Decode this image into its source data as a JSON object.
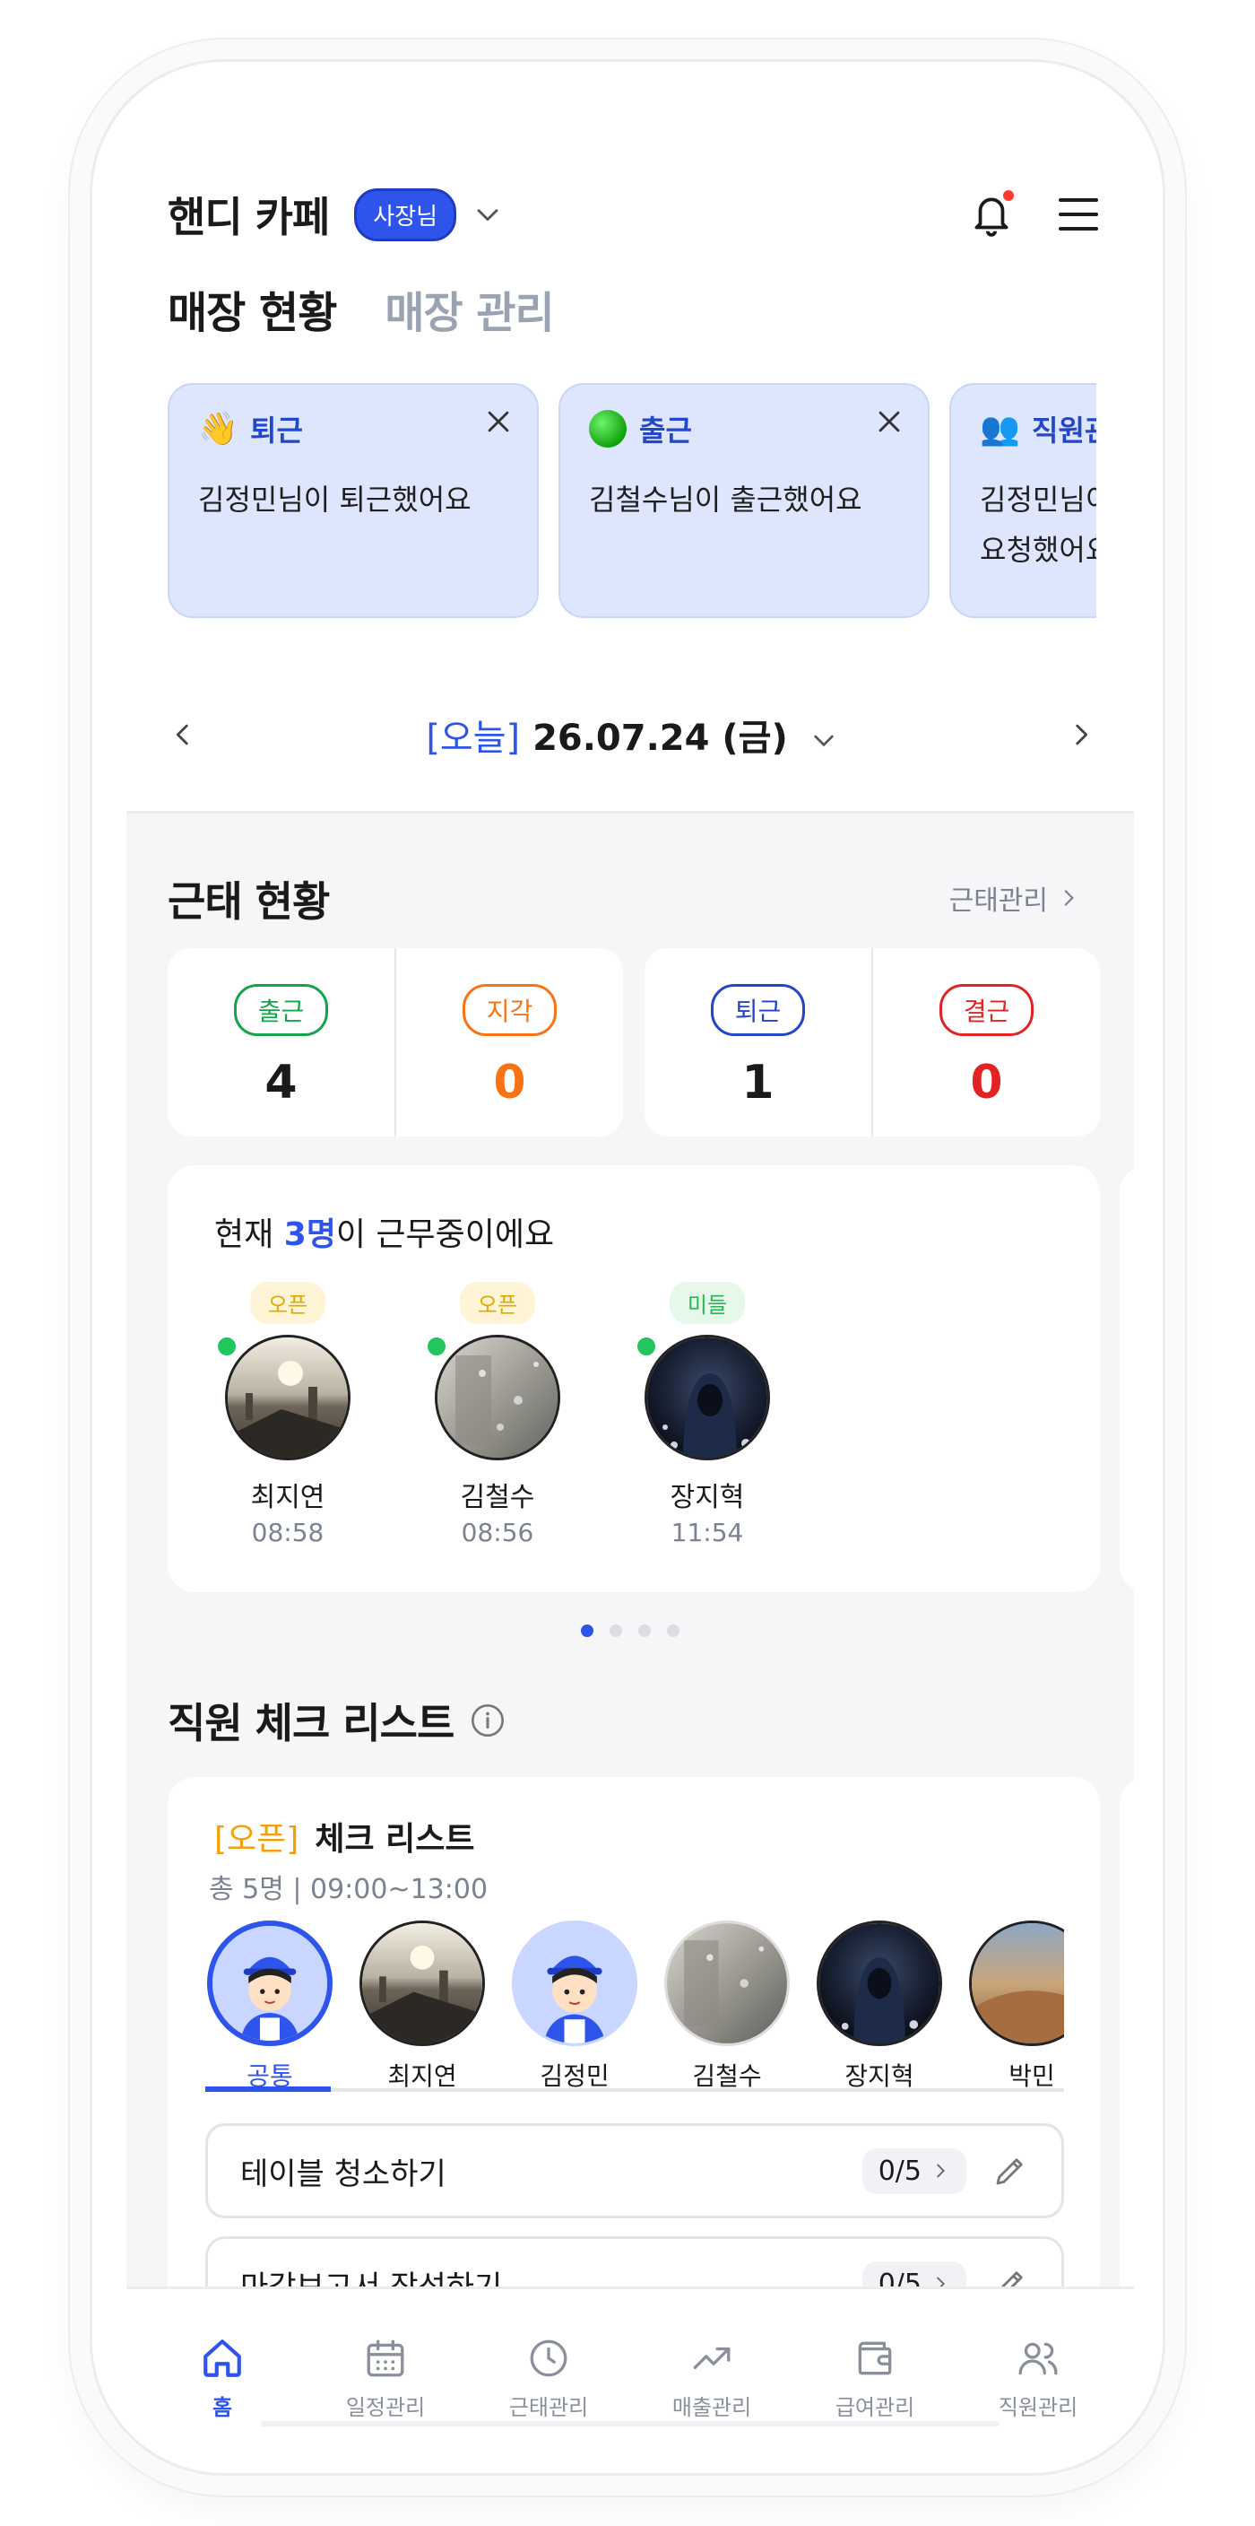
{
  "header": {
    "store_name": "핸디 카페",
    "role_badge": "사장님"
  },
  "tabs": [
    {
      "label": "매장 현황",
      "active": true
    },
    {
      "label": "매장 관리",
      "active": false
    }
  ],
  "notifications": [
    {
      "icon": "wave-emoji",
      "type": "퇴근",
      "message": "김정민님이 퇴근했어요"
    },
    {
      "icon": "green-circle",
      "type": "출근",
      "message": "김철수님이 출근했어요"
    },
    {
      "icon": "people-emoji",
      "type": "직원관리",
      "message": "김정민님이 미 요청했어요"
    }
  ],
  "date_nav": {
    "today_tag": "[오늘]",
    "date": "26.07.24 (금)"
  },
  "attendance": {
    "title": "근태 현황",
    "link": "근태관리",
    "stats": [
      {
        "label": "출근",
        "value": "4",
        "color": "#16a34a"
      },
      {
        "label": "지각",
        "value": "0",
        "color": "#f97316"
      },
      {
        "label": "퇴근",
        "value": "1",
        "color": "#2446c8"
      },
      {
        "label": "결근",
        "value": "0",
        "color": "#e02424"
      }
    ]
  },
  "working_now": {
    "prefix": "현재 ",
    "count": "3명",
    "suffix": "이 근무중이에요",
    "workers": [
      {
        "shift": "오픈",
        "name": "최지연",
        "time": "08:58",
        "photo": "city-sunset"
      },
      {
        "shift": "오픈",
        "name": "김철수",
        "time": "08:56",
        "photo": "rainy-window"
      },
      {
        "shift": "미들",
        "name": "장지혁",
        "time": "11:54",
        "photo": "hooded-figure"
      }
    ],
    "pager": {
      "count": 4,
      "active": 0
    }
  },
  "checklist": {
    "title": "직원 체크 리스트",
    "shift": "[오픈]",
    "name": "체크 리스트",
    "summary": "총 5명 | 09:00~13:00",
    "people": [
      {
        "name": "공통",
        "selected": true,
        "photo": "cartoon-avatar"
      },
      {
        "name": "최지연",
        "selected": false,
        "photo": "city-sunset"
      },
      {
        "name": "김정민",
        "selected": false,
        "photo": "cartoon-avatar"
      },
      {
        "name": "김철수",
        "selected": false,
        "photo": "rainy-window"
      },
      {
        "name": "장지혁",
        "selected": false,
        "photo": "hooded-figure"
      },
      {
        "name": "박민",
        "selected": false,
        "photo": "desert-dune"
      }
    ],
    "tasks": [
      {
        "label": "테이블 청소하기",
        "progress": "0/5"
      },
      {
        "label": "마감보고서 작성하기",
        "progress": "0/5"
      }
    ]
  },
  "bottom_nav": [
    {
      "label": "홈",
      "icon": "home-icon",
      "active": true
    },
    {
      "label": "일정관리",
      "icon": "calendar-icon",
      "active": false
    },
    {
      "label": "근태관리",
      "icon": "clock-icon",
      "active": false
    },
    {
      "label": "매출관리",
      "icon": "trend-icon",
      "active": false
    },
    {
      "label": "급여관리",
      "icon": "wallet-icon",
      "active": false
    },
    {
      "label": "직원관리",
      "icon": "users-icon",
      "active": false
    }
  ],
  "colors": {
    "accent": "#2f54eb",
    "notif_bg": "#dde6fc",
    "open_shift": "#f59e0b",
    "online": "#22c55e"
  }
}
